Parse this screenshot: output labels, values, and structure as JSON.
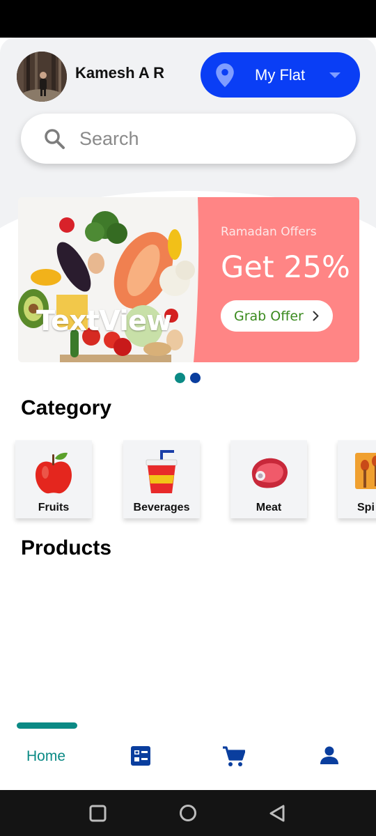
{
  "header": {
    "user_name": "Kamesh A R",
    "location_label": "My Flat"
  },
  "search": {
    "placeholder": "Search"
  },
  "banner": {
    "subtitle": "Ramadan Offers",
    "title": "Get 25%",
    "button_label": "Grab Offer",
    "overlay_text": "TextView",
    "slides": 2,
    "active_slide": 1
  },
  "sections": {
    "category_title": "Category",
    "products_title": "Products"
  },
  "categories": [
    {
      "label": "Fruits",
      "icon": "apple-icon"
    },
    {
      "label": "Beverages",
      "icon": "drink-cup-icon"
    },
    {
      "label": "Meat",
      "icon": "meat-icon"
    },
    {
      "label": "Spi",
      "icon": "spices-icon"
    }
  ],
  "bottom_nav": {
    "home_label": "Home",
    "items": [
      "home",
      "list-icon",
      "cart-icon",
      "profile-icon"
    ]
  },
  "colors": {
    "accent_blue": "#0a3ef5",
    "teal": "#0b8a85",
    "banner_pink": "#ff8585",
    "offer_green": "#3a8a1e",
    "nav_icon_blue": "#0a3e9e"
  }
}
